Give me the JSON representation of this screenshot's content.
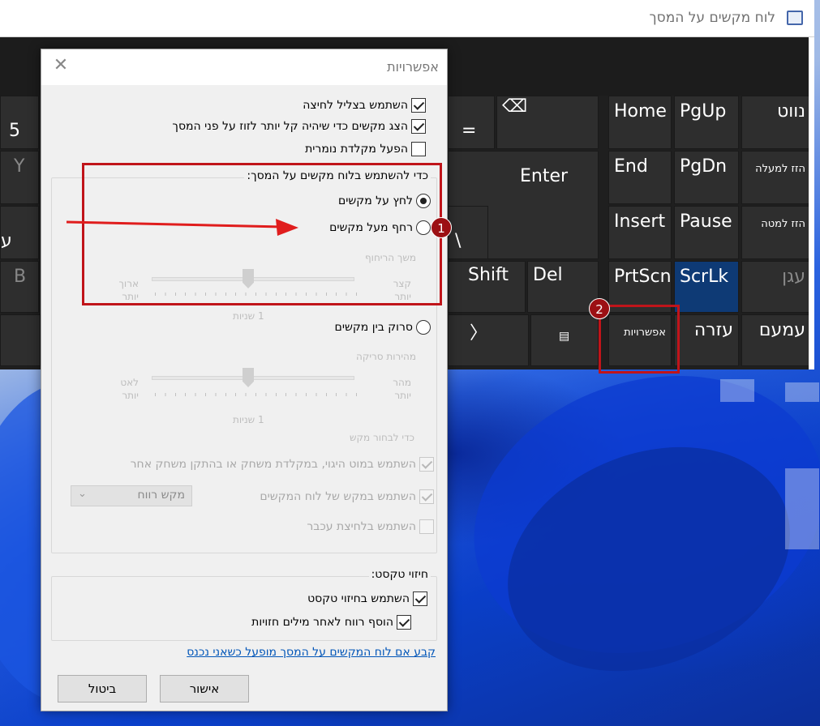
{
  "osk": {
    "title": "לוח מקשים על המסך",
    "keys": {
      "five": "5",
      "equals": "=",
      "backspace_glyph": "⌫",
      "y": "Y",
      "ayin": "ע",
      "b": "B",
      "enter": "Enter",
      "backslash": "\\",
      "shift": "Shift",
      "del": "Del",
      "chevron": "〉",
      "menu_glyph": "▤",
      "home": "Home",
      "pgup": "PgUp",
      "nav": "נווט",
      "end": "End",
      "pgdn": "PgDn",
      "move_up": "הזז למעלה",
      "insert": "Insert",
      "pause": "Pause",
      "move_down": "הזז למטה",
      "prtscn": "PrtScn",
      "scrlk": "ScrLk",
      "dock": "עגן",
      "options": "אפשרויות",
      "help": "עזרה",
      "fade": "עמעם"
    }
  },
  "dialog": {
    "title": "אפשרויות",
    "close_glyph": "✕",
    "opt_click_sound": "השתמש בצליל לחיצה",
    "opt_show_keys": "הצג מקשים כדי שיהיה קל יותר לזוז על פני המסך",
    "opt_numpad": "הפעל מקלדת נומרית",
    "group_use_title": "כדי להשתמש בלוח מקשים על המסך:",
    "radio_click": "לחץ על מקשים",
    "radio_hover": "רחף מעל מקשים",
    "hover_duration_label": "משך הריחוף",
    "slider_short": "קצר",
    "slider_short2": "יותר",
    "slider_long": "ארוך",
    "slider_long2": "יותר",
    "slider_value": "1 שניות",
    "radio_scan": "סרוק בין מקשים",
    "scan_speed_label": "מהירות סריקה",
    "scan_fast": "מהר",
    "scan_fast2": "יותר",
    "scan_slow": "לאט",
    "scan_slow2": "יותר",
    "scan_value": "1 שניות",
    "select_key_label": "כדי לבחור מקש",
    "opt_joystick": "השתמש במוט היגוי, במקלדת משחק או בהתקן משחק אחר",
    "opt_osk_key": "השתמש במקש של לוח המקשים",
    "select_value": "מקש רווח",
    "opt_mouse_click": "השתמש בלחיצת עכבר",
    "group_text_title": "חיזוי טקסט:",
    "opt_text_prediction": "השתמש בחיזוי טקסט",
    "opt_add_space": "הוסף רווח לאחר מילים חזויות",
    "link_startup": "קבע אם לוח המקשים על המסך מופעל כשאני נכנס",
    "btn_ok": "אישור",
    "btn_cancel": "ביטול"
  },
  "annotations": {
    "badge1": "1",
    "badge2": "2",
    "annotation_color": "#c0141a"
  }
}
